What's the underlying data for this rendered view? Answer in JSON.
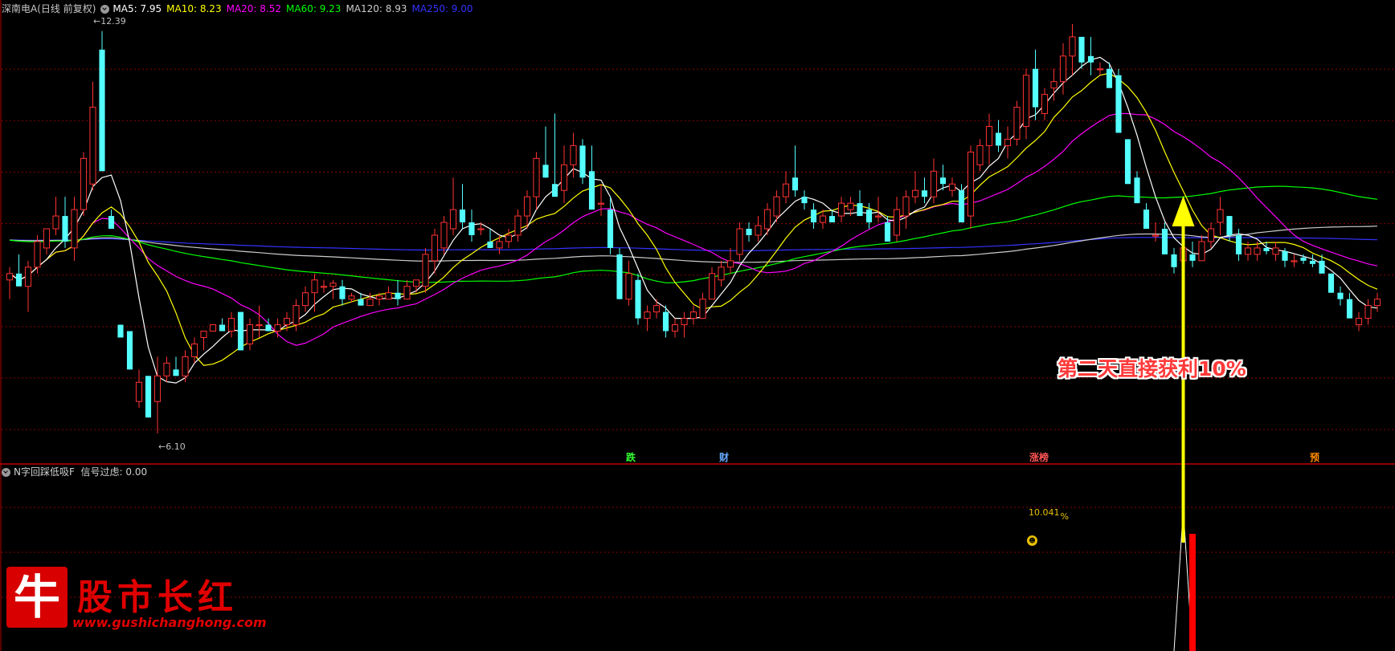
{
  "header": {
    "stock": "深南电A(日线 前复权)",
    "ma": [
      {
        "label": "MA5: 7.95",
        "color": "#ffffff"
      },
      {
        "label": "MA10: 8.23",
        "color": "#ffff00"
      },
      {
        "label": "MA20: 8.52",
        "color": "#ff00ff"
      },
      {
        "label": "MA60: 9.23",
        "color": "#00ff00"
      },
      {
        "label": "MA120: 8.93",
        "color": "#cccccc"
      },
      {
        "label": "MA250: 9.00",
        "color": "#3333ff"
      }
    ]
  },
  "indicator": {
    "label": "N字回踩低吸F",
    "value": "信号过虑: 0.00",
    "pct": "10.041",
    "pct_unit": "%"
  },
  "annotation": "第二天直接获利10%",
  "max_label": "12.39",
  "min_label": "6.10",
  "signals": [
    {
      "text": "跌",
      "color": "#33ff33",
      "x": 785
    },
    {
      "text": "财",
      "color": "#66aaff",
      "x": 901
    },
    {
      "text": "涨榜",
      "color": "#ff5555",
      "x": 1287
    },
    {
      "text": "预",
      "color": "#ff8800",
      "x": 1636
    }
  ],
  "logo": {
    "glyph": "牛",
    "name": "股市长红",
    "url": "www.gushichanghong.com"
  },
  "colors": {
    "up": "#ff3232",
    "down": "#54ffff",
    "grid": "#8b0000",
    "arrow": "#ffff00"
  },
  "chart_data": {
    "type": "candlestick",
    "ma_colors": {
      "ma5": "#ffffff",
      "ma10": "#ffff00",
      "ma20": "#ff00ff",
      "ma60": "#00ff00",
      "ma120": "#cccccc",
      "ma250": "#3333ff"
    },
    "ohlc": [
      [
        8.5,
        8.7,
        8.2,
        8.6
      ],
      [
        8.6,
        8.9,
        8.4,
        8.4
      ],
      [
        8.4,
        8.8,
        8.0,
        8.7
      ],
      [
        8.7,
        9.2,
        8.6,
        9.1
      ],
      [
        9.0,
        9.3,
        8.9,
        9.3
      ],
      [
        9.3,
        9.8,
        9.2,
        9.5
      ],
      [
        9.5,
        9.8,
        9.0,
        9.1
      ],
      [
        9.0,
        9.8,
        8.8,
        9.6
      ],
      [
        9.6,
        10.5,
        9.5,
        10.4
      ],
      [
        10.0,
        11.6,
        9.9,
        11.2
      ],
      [
        12.1,
        12.39,
        10.2,
        10.2
      ],
      [
        9.5,
        9.6,
        9.3,
        9.3
      ],
      [
        7.8,
        7.8,
        7.6,
        7.6
      ],
      [
        7.7,
        7.7,
        7.1,
        7.1
      ],
      [
        6.6,
        7.1,
        6.5,
        6.9
      ],
      [
        7.0,
        7.0,
        6.35,
        6.35
      ],
      [
        6.6,
        7.3,
        6.1,
        7.0
      ],
      [
        7.0,
        7.3,
        6.9,
        7.2
      ],
      [
        7.1,
        7.3,
        7.0,
        7.0
      ],
      [
        7.0,
        7.4,
        6.9,
        7.3
      ],
      [
        7.3,
        7.6,
        7.2,
        7.5
      ],
      [
        7.6,
        7.7,
        7.4,
        7.7
      ],
      [
        7.7,
        7.8,
        7.7,
        7.8
      ],
      [
        7.8,
        7.9,
        7.7,
        7.7
      ],
      [
        7.7,
        8.0,
        7.6,
        7.9
      ],
      [
        8.0,
        8.0,
        7.4,
        7.4
      ],
      [
        7.5,
        7.9,
        7.4,
        7.8
      ],
      [
        7.8,
        8.1,
        7.6,
        7.8
      ],
      [
        7.8,
        7.9,
        7.7,
        7.7
      ],
      [
        7.7,
        7.9,
        7.6,
        7.8
      ],
      [
        7.8,
        8.0,
        7.7,
        7.9
      ],
      [
        7.8,
        8.2,
        7.7,
        8.1
      ],
      [
        8.1,
        8.4,
        8.0,
        8.3
      ],
      [
        8.3,
        8.6,
        8.0,
        8.5
      ],
      [
        8.4,
        8.5,
        8.3,
        8.4
      ],
      [
        8.4,
        8.5,
        8.2,
        8.45
      ],
      [
        8.4,
        8.5,
        8.1,
        8.2
      ],
      [
        8.2,
        8.3,
        8.15,
        8.25
      ],
      [
        8.2,
        8.3,
        8.1,
        8.1
      ],
      [
        8.1,
        8.3,
        8.1,
        8.2
      ],
      [
        8.2,
        8.3,
        8.1,
        8.25
      ],
      [
        8.2,
        8.4,
        8.2,
        8.3
      ],
      [
        8.3,
        8.5,
        8.1,
        8.2
      ],
      [
        8.2,
        8.5,
        8.2,
        8.4
      ],
      [
        8.4,
        8.5,
        8.3,
        8.5
      ],
      [
        8.4,
        9.0,
        8.3,
        8.9
      ],
      [
        8.8,
        9.3,
        8.6,
        9.2
      ],
      [
        9.0,
        9.5,
        8.9,
        9.4
      ],
      [
        9.3,
        10.1,
        9.2,
        9.6
      ],
      [
        9.6,
        10.0,
        9.3,
        9.4
      ],
      [
        9.4,
        9.6,
        9.1,
        9.2
      ],
      [
        9.3,
        9.4,
        9.2,
        9.3
      ],
      [
        9.1,
        9.3,
        9.0,
        9.0
      ],
      [
        9.0,
        9.2,
        8.9,
        9.1
      ],
      [
        9.1,
        9.3,
        9.0,
        9.2
      ],
      [
        9.2,
        9.6,
        9.1,
        9.5
      ],
      [
        9.5,
        9.9,
        9.3,
        9.8
      ],
      [
        9.8,
        10.5,
        9.6,
        10.4
      ],
      [
        10.3,
        10.9,
        10.1,
        10.1
      ],
      [
        10.0,
        11.1,
        9.8,
        9.8
      ],
      [
        9.9,
        10.6,
        9.7,
        10.3
      ],
      [
        10.3,
        10.8,
        10.1,
        10.6
      ],
      [
        10.6,
        10.7,
        10.0,
        10.1
      ],
      [
        10.2,
        10.6,
        9.6,
        9.6
      ],
      [
        9.7,
        10.0,
        9.5,
        9.7
      ],
      [
        9.6,
        9.8,
        8.9,
        9.0
      ],
      [
        8.9,
        9.0,
        8.2,
        8.2
      ],
      [
        8.2,
        8.8,
        8.1,
        8.6
      ],
      [
        8.5,
        8.6,
        7.8,
        7.9
      ],
      [
        7.9,
        8.1,
        7.7,
        8.0
      ],
      [
        8.0,
        8.2,
        7.9,
        8.1
      ],
      [
        8.0,
        8.1,
        7.6,
        7.7
      ],
      [
        7.7,
        7.9,
        7.6,
        7.8
      ],
      [
        7.8,
        8.0,
        7.6,
        7.9
      ],
      [
        7.9,
        8.1,
        7.8,
        8.0
      ],
      [
        7.9,
        8.3,
        7.9,
        8.2
      ],
      [
        8.2,
        8.7,
        8.2,
        8.6
      ],
      [
        8.5,
        8.8,
        8.4,
        8.7
      ],
      [
        8.7,
        9.0,
        8.6,
        8.8
      ],
      [
        8.9,
        9.4,
        8.8,
        9.3
      ],
      [
        9.3,
        9.4,
        9.1,
        9.2
      ],
      [
        9.2,
        9.5,
        9.1,
        9.35
      ],
      [
        9.3,
        9.7,
        9.2,
        9.6
      ],
      [
        9.5,
        9.9,
        9.4,
        9.8
      ],
      [
        9.8,
        10.2,
        9.7,
        10.0
      ],
      [
        10.1,
        10.6,
        9.8,
        9.9
      ],
      [
        9.8,
        9.9,
        9.6,
        9.7
      ],
      [
        9.6,
        9.7,
        9.3,
        9.4
      ],
      [
        9.4,
        9.6,
        9.3,
        9.5
      ],
      [
        9.5,
        9.6,
        9.4,
        9.4
      ],
      [
        9.5,
        9.8,
        9.4,
        9.7
      ],
      [
        9.6,
        9.8,
        9.5,
        9.7
      ],
      [
        9.7,
        9.9,
        9.5,
        9.5
      ],
      [
        9.6,
        9.7,
        9.3,
        9.4
      ],
      [
        9.5,
        9.8,
        9.4,
        9.5
      ],
      [
        9.4,
        9.5,
        9.1,
        9.1
      ],
      [
        9.2,
        9.8,
        9.1,
        9.6
      ],
      [
        9.5,
        9.9,
        9.3,
        9.8
      ],
      [
        9.8,
        10.2,
        9.7,
        9.9
      ],
      [
        9.9,
        10.1,
        9.7,
        9.8
      ],
      [
        9.8,
        10.4,
        9.7,
        10.2
      ],
      [
        10.1,
        10.3,
        9.9,
        10.0
      ],
      [
        9.9,
        10.1,
        9.8,
        10.0
      ],
      [
        9.9,
        10.0,
        9.4,
        9.4
      ],
      [
        9.5,
        10.6,
        9.3,
        10.5
      ],
      [
        10.3,
        10.7,
        10.2,
        10.6
      ],
      [
        10.6,
        11.1,
        10.3,
        10.9
      ],
      [
        10.8,
        11.0,
        10.5,
        10.6
      ],
      [
        10.6,
        10.9,
        10.4,
        10.7
      ],
      [
        10.7,
        11.3,
        10.6,
        11.2
      ],
      [
        10.9,
        11.8,
        10.7,
        11.7
      ],
      [
        11.8,
        12.1,
        11.0,
        11.2
      ],
      [
        11.1,
        11.5,
        11.0,
        11.4
      ],
      [
        11.5,
        11.8,
        11.3,
        11.6
      ],
      [
        11.6,
        12.2,
        11.4,
        12.0
      ],
      [
        12.0,
        12.5,
        11.7,
        12.3
      ],
      [
        12.3,
        12.3,
        11.8,
        11.9
      ],
      [
        12.0,
        12.3,
        11.7,
        11.9
      ],
      [
        11.8,
        11.9,
        11.7,
        11.8
      ],
      [
        11.8,
        11.9,
        11.5,
        11.5
      ],
      [
        11.7,
        11.8,
        10.8,
        10.8
      ],
      [
        10.7,
        10.7,
        10.0,
        10.0
      ],
      [
        10.1,
        10.2,
        9.7,
        9.7
      ],
      [
        9.6,
        9.7,
        9.3,
        9.3
      ],
      [
        9.2,
        9.4,
        9.1,
        9.2
      ],
      [
        9.3,
        9.4,
        8.9,
        8.9
      ],
      [
        8.9,
        9.0,
        8.6,
        8.7
      ],
      [
        8.8,
        9.1,
        8.7,
        9.0
      ],
      [
        8.9,
        9.1,
        8.7,
        8.8
      ],
      [
        8.8,
        9.2,
        8.8,
        9.1
      ],
      [
        9.1,
        9.4,
        9.0,
        9.3
      ],
      [
        9.4,
        9.8,
        9.2,
        9.6
      ],
      [
        9.5,
        9.5,
        9.1,
        9.2
      ],
      [
        9.2,
        9.3,
        8.8,
        8.9
      ],
      [
        8.9,
        9.1,
        8.8,
        9.0
      ],
      [
        8.9,
        9.1,
        8.8,
        9.0
      ],
      [
        9.0,
        9.1,
        8.9,
        8.95
      ],
      [
        8.9,
        9.1,
        8.8,
        9.0
      ],
      [
        8.95,
        9.0,
        8.7,
        8.8
      ],
      [
        8.8,
        8.9,
        8.7,
        8.8
      ],
      [
        8.85,
        8.9,
        8.75,
        8.8
      ],
      [
        8.8,
        8.9,
        8.7,
        8.75
      ],
      [
        8.8,
        8.9,
        8.6,
        8.6
      ],
      [
        8.6,
        8.6,
        8.3,
        8.3
      ],
      [
        8.3,
        8.4,
        8.1,
        8.2
      ],
      [
        8.2,
        8.3,
        7.9,
        7.9
      ],
      [
        7.8,
        8.0,
        7.7,
        7.9
      ],
      [
        7.9,
        8.2,
        7.8,
        8.1
      ],
      [
        8.1,
        8.3,
        8.0,
        8.2
      ]
    ],
    "ylim": [
      6.0,
      12.6
    ],
    "max": 12.39,
    "min": 6.1,
    "indicator_ylim": [
      0,
      12
    ],
    "indicator_line": {
      "start_index": 126,
      "peak": 10.041,
      "end_index": 128
    },
    "indicator_bar": {
      "index": 128,
      "from": 0,
      "to": 8.3
    }
  }
}
